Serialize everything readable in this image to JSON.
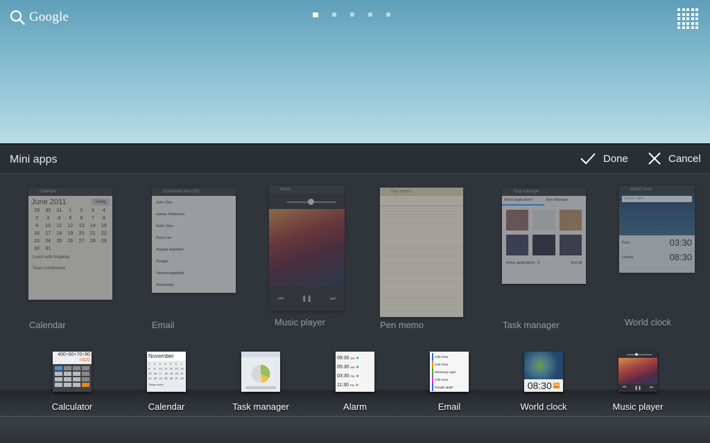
{
  "home": {
    "search_label": "Google",
    "search_icon": "search-icon",
    "apps_icon": "apps-grid-icon",
    "page_count": 5,
    "active_page": 1
  },
  "panel": {
    "title": "Mini apps",
    "done_label": "Done",
    "cancel_label": "Cancel"
  },
  "previews": [
    {
      "label": "Calendar",
      "window_title": "Calendar",
      "month": "June 2011",
      "today_label": "Today",
      "event_1": "Lunch with Angelina",
      "event_2": "Team Conference"
    },
    {
      "label": "Email",
      "window_title": "Combined view (50)",
      "senders": [
        "John Doe",
        "James Robinson",
        "Katie Stou",
        "Tony Lee",
        "Angela Hamilton",
        "Google",
        "Samsungapplide",
        "Anonymity"
      ]
    },
    {
      "label": "Music player",
      "window_title": "Music"
    },
    {
      "label": "Pen memo",
      "window_title": "Pen memo",
      "save_label": "Save"
    },
    {
      "label": "Task manager",
      "window_title": "Task manager",
      "tab_1": "Active applications",
      "tab_2": "Ram Manager",
      "footer_label": "Active applications : 6",
      "end_all_label": "End all"
    },
    {
      "label": "World clock",
      "window_title": "World clock",
      "search_placeholder": "Search cities",
      "city_1": "Paris",
      "time_1": "03:30",
      "city_2": "London",
      "time_2": "08:30"
    }
  ],
  "dock": [
    {
      "label": "Calculator",
      "display": "400÷60+70÷90",
      "result": "=620"
    },
    {
      "label": "Calendar",
      "month": "November",
      "footer": "Today event"
    },
    {
      "label": "Task manager"
    },
    {
      "label": "Alarm",
      "times": [
        "09:30",
        "05:30",
        "03:30",
        "11:30"
      ],
      "suffixes": [
        "AM",
        "AM",
        "PM",
        "PM"
      ]
    },
    {
      "label": "Email",
      "senders": [
        "John Doe",
        "John Doe",
        "Samsung Apps",
        "John Doe",
        "Google apple"
      ]
    },
    {
      "label": "World clock",
      "time": "08:30",
      "suffix": "PM"
    },
    {
      "label": "Music player"
    }
  ]
}
